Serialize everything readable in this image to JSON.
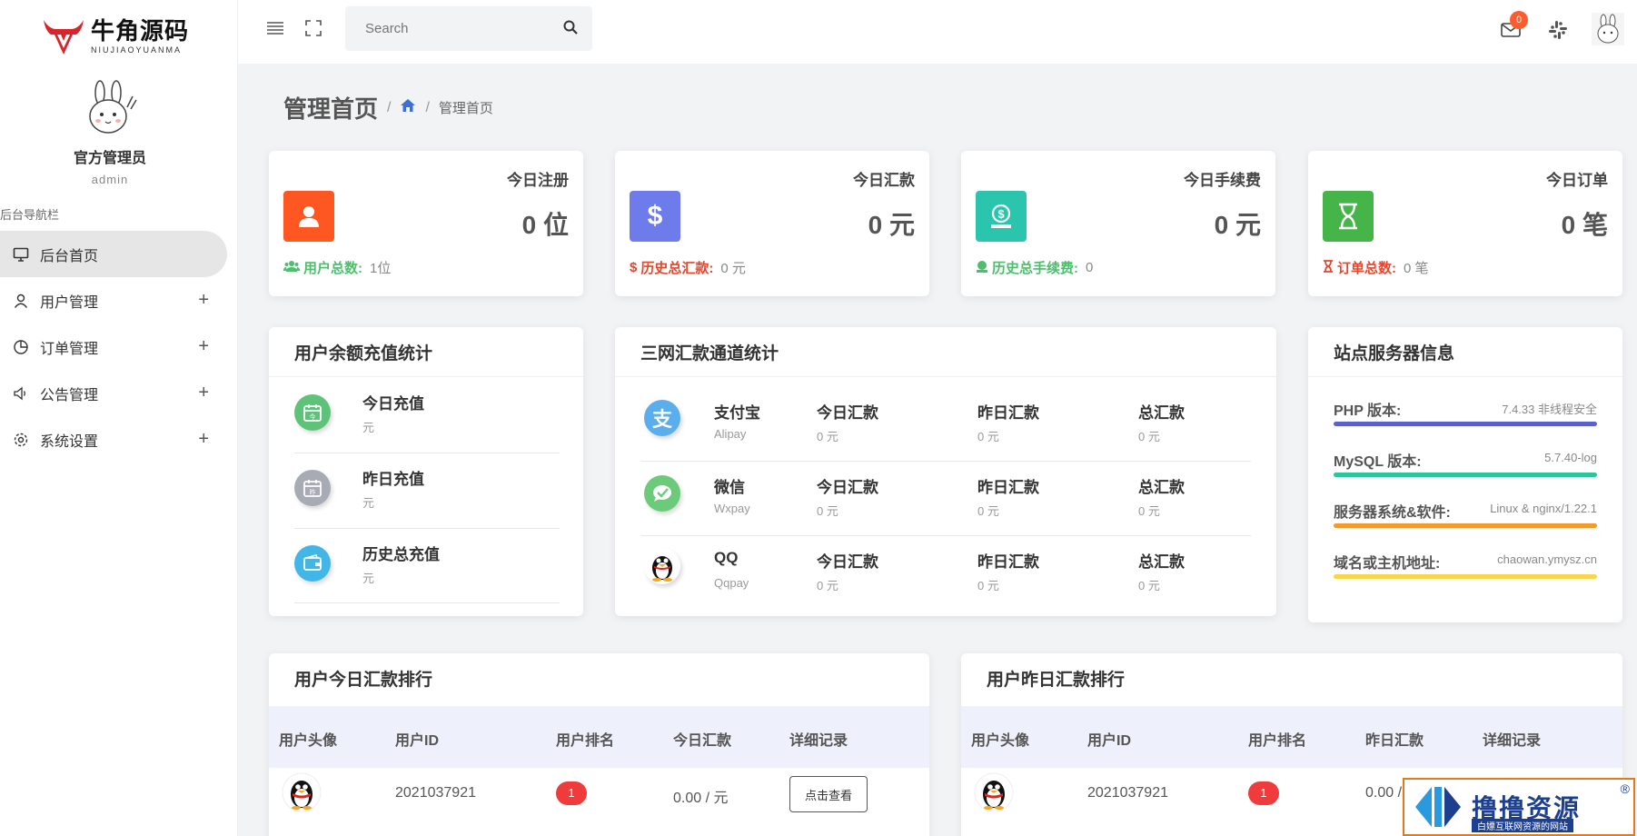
{
  "brand": {
    "name_cn": "牛角源码",
    "name_en": "NIUJIAOYUANMA"
  },
  "profile": {
    "name": "官方管理员",
    "username": "admin"
  },
  "sidebar": {
    "title": "后台导航栏",
    "items": [
      {
        "label": "后台首页",
        "icon": "monitor-icon",
        "active": true
      },
      {
        "label": "用户管理",
        "icon": "user-icon",
        "expand": "+"
      },
      {
        "label": "订单管理",
        "icon": "pie-chart-icon",
        "expand": "+"
      },
      {
        "label": "公告管理",
        "icon": "speaker-icon",
        "expand": "+"
      },
      {
        "label": "系统设置",
        "icon": "gear-icon",
        "expand": "+"
      }
    ]
  },
  "topbar": {
    "search_placeholder": "Search",
    "mail_badge": "0"
  },
  "breadcrumb": {
    "title": "管理首页",
    "sep": "/",
    "current": "管理首页"
  },
  "stats": [
    {
      "label": "今日注册",
      "value": "0 位",
      "foot_label": "用户总数:",
      "foot_value": "1位",
      "color": "#ff5722",
      "foot_color": "#4cbe6c"
    },
    {
      "label": "今日汇款",
      "value": "0 元",
      "foot_label": "历史总汇款:",
      "foot_value": "0 元",
      "color": "#6e7bea",
      "foot_color": "#e8452c"
    },
    {
      "label": "今日手续费",
      "value": "0 元",
      "foot_label": "历史总手续费:",
      "foot_value": "0",
      "color": "#2bc4ad",
      "foot_color": "#4cbe6c"
    },
    {
      "label": "今日订单",
      "value": "0 笔",
      "foot_label": "订单总数:",
      "foot_value": "0 笔",
      "color": "#45b549",
      "foot_color": "#e8452c"
    }
  ],
  "recharge": {
    "title": "用户余额充值统计",
    "rows": [
      {
        "title": "今日充值",
        "unit": "元",
        "icon_color": "#5fc27a"
      },
      {
        "title": "昨日充值",
        "unit": "元",
        "icon_color": "#a8aab4"
      },
      {
        "title": "历史总充值",
        "unit": "元",
        "icon_color": "#42b6e6"
      }
    ]
  },
  "channels": {
    "title": "三网汇款通道统计",
    "rows": [
      {
        "name": "支付宝",
        "code": "Alipay",
        "today_label": "今日汇款",
        "today": "0 元",
        "yest_label": "昨日汇款",
        "yest": "0 元",
        "total_label": "总汇款",
        "total": "0 元",
        "icon_color": "#5aaeec"
      },
      {
        "name": "微信",
        "code": "Wxpay",
        "today_label": "今日汇款",
        "today": "0 元",
        "yest_label": "昨日汇款",
        "yest": "0 元",
        "total_label": "总汇款",
        "total": "0 元",
        "icon_color": "#6ccb7a"
      },
      {
        "name": "QQ",
        "code": "Qqpay",
        "today_label": "今日汇款",
        "today": "0 元",
        "yest_label": "昨日汇款",
        "yest": "0 元",
        "total_label": "总汇款",
        "total": "0 元",
        "icon_color": "#ffffff"
      }
    ]
  },
  "server": {
    "title": "站点服务器信息",
    "rows": [
      {
        "label": "PHP 版本:",
        "value": "7.4.33 非线程安全",
        "color": "#5a62c8"
      },
      {
        "label": "MySQL 版本:",
        "value": "5.7.40-log",
        "color": "#2cc49a"
      },
      {
        "label": "服务器系统&软件:",
        "value": "Linux & nginx/1.22.1",
        "color": "#f29a2e"
      },
      {
        "label": "域名或主机地址:",
        "value": "chaowan.ymysz.cn",
        "color": "#f7d64a"
      }
    ]
  },
  "today_rank": {
    "title": "用户今日汇款排行",
    "headers": [
      "用户头像",
      "用户ID",
      "用户排名",
      "今日汇款",
      "详细记录"
    ],
    "row": {
      "id": "2021037921",
      "rank": "1",
      "amount": "0.00 / 元",
      "button": "点击查看"
    }
  },
  "yest_rank": {
    "title": "用户昨日汇款排行",
    "headers": [
      "用户头像",
      "用户ID",
      "用户排名",
      "昨日汇款",
      "详细记录"
    ],
    "row": {
      "id": "2021037921",
      "rank": "1",
      "amount": "0.00 /"
    }
  },
  "watermark": {
    "text": "撸撸资源",
    "mark": "®",
    "sub": "白嫖互联网资源的网站"
  }
}
